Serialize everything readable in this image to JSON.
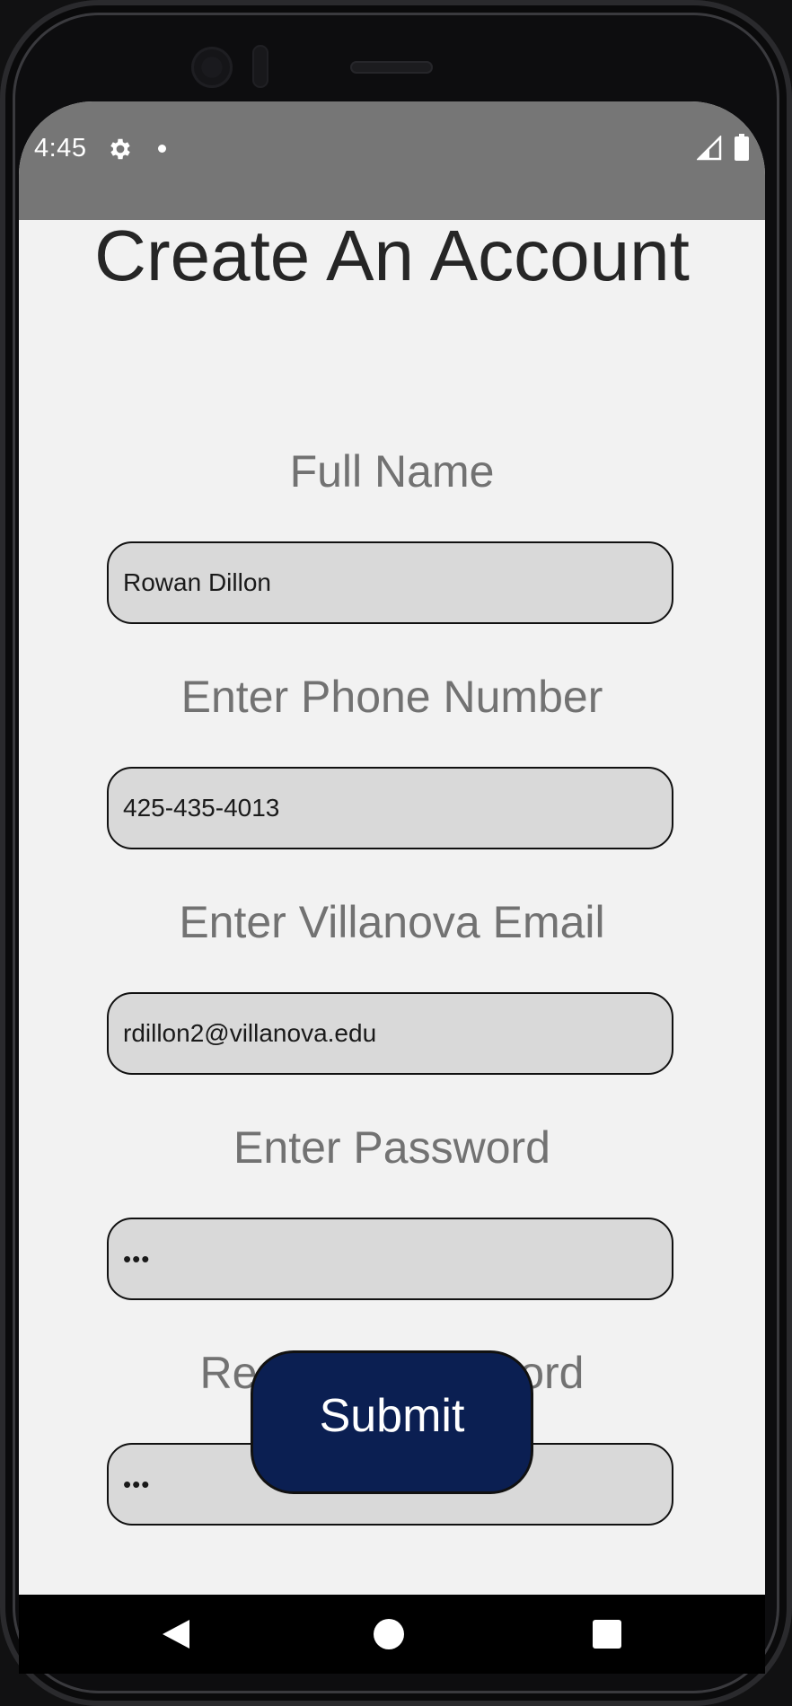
{
  "status_bar": {
    "time": "4:45",
    "icons": [
      "gear-icon",
      "notification-dot-icon",
      "signal-icon",
      "battery-icon"
    ]
  },
  "page": {
    "title": "Create An Account"
  },
  "form": {
    "full_name": {
      "label": "Full Name",
      "value": "Rowan Dillon"
    },
    "phone": {
      "label": "Enter Phone Number",
      "value": "425-435-4013"
    },
    "email": {
      "label": "Enter Villanova Email",
      "value": "rdillon2@villanova.edu"
    },
    "password": {
      "label": "Enter Password",
      "value": "•••"
    },
    "confirm_password": {
      "label": "Re-enter Password",
      "value": "•••"
    },
    "submit_label": "Submit"
  },
  "nav_bar": {
    "icons": [
      "back-icon",
      "home-icon",
      "recent-apps-icon"
    ]
  },
  "colors": {
    "status_bar": "#767676",
    "background": "#f2f2f2",
    "input_fill": "#d9d9d9",
    "submit_fill": "#0b1f52",
    "label_text": "#727272"
  }
}
